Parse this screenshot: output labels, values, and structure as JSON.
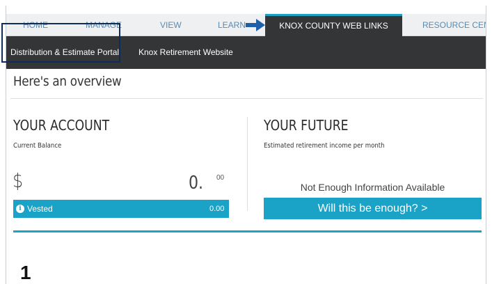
{
  "nav": {
    "home": "HOME",
    "manage": "MANAGE",
    "view": "VIEW",
    "learn": "LEARN",
    "knox_links": "KNOX COUNTY WEB LINKS",
    "resource": "RESOURCE CENTE"
  },
  "subnav": {
    "distribution": "Distribution & Estimate Portal",
    "knox_retirement": "Knox Retirement Website"
  },
  "overview_title": "Here's an overview",
  "account": {
    "title": "YOUR ACCOUNT",
    "balance_label": "Current Balance",
    "currency": "$",
    "amount": "0.",
    "cents": "00",
    "vested_label": "Vested",
    "vested_value": "0.00"
  },
  "future": {
    "title": "YOUR FUTURE",
    "income_label": "Estimated retirement income per month",
    "status": "Not Enough Information Available",
    "button_label": "Will this be enough? >"
  },
  "step_number": "1",
  "colors": {
    "accent": "#1aa3c7",
    "nav_dark": "#333537",
    "highlight_box": "#0f2b57",
    "arrow": "#1f5fa8"
  }
}
